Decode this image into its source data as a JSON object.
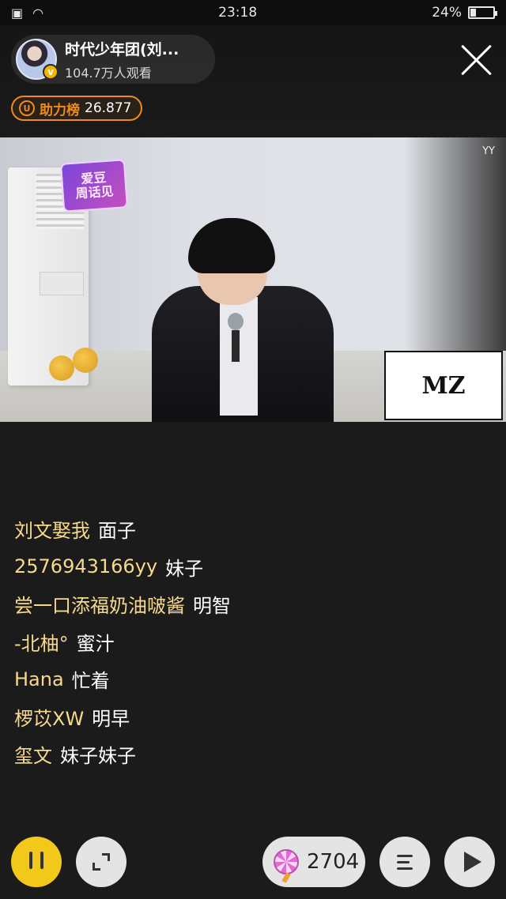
{
  "status_bar": {
    "time": "23:18",
    "battery": "24%",
    "battery_level": 0.24
  },
  "anchor": {
    "name": "时代少年团(刘...",
    "viewers": "104.7万人观看",
    "verified_mark": "v"
  },
  "support_rank": {
    "icon_glyph": "U",
    "label": "助力榜",
    "value": "26.877"
  },
  "video": {
    "watermark": "YY",
    "show_logo_text": "爱豆\n周话见",
    "card_text": "MZ"
  },
  "chat": [
    {
      "user": "刘文娶我",
      "text": "面子"
    },
    {
      "user": "2576943166yy",
      "text": "妹子"
    },
    {
      "user": "尝一口添福奶油啵酱",
      "text": "明智"
    },
    {
      "user": "-北柚°",
      "text": "蜜汁"
    },
    {
      "user": "Hana",
      "text": "忙着"
    },
    {
      "user": "椤苡XW",
      "text": "明早"
    },
    {
      "user": "玺文",
      "text": "妹子妹子"
    }
  ],
  "bottom_bar": {
    "gift_count": "2704"
  },
  "icons": {
    "close": "close-icon",
    "pause": "pause-icon",
    "fullscreen": "fullscreen-icon",
    "gift": "lollipop-icon",
    "menu": "menu-icon",
    "share": "share-icon",
    "rank": "shield-icon"
  },
  "colors": {
    "accent_orange": "#f08a1a",
    "pause_yellow": "#f2c81b",
    "chat_user": "#f6d98a",
    "background": "#1b1b1b"
  }
}
